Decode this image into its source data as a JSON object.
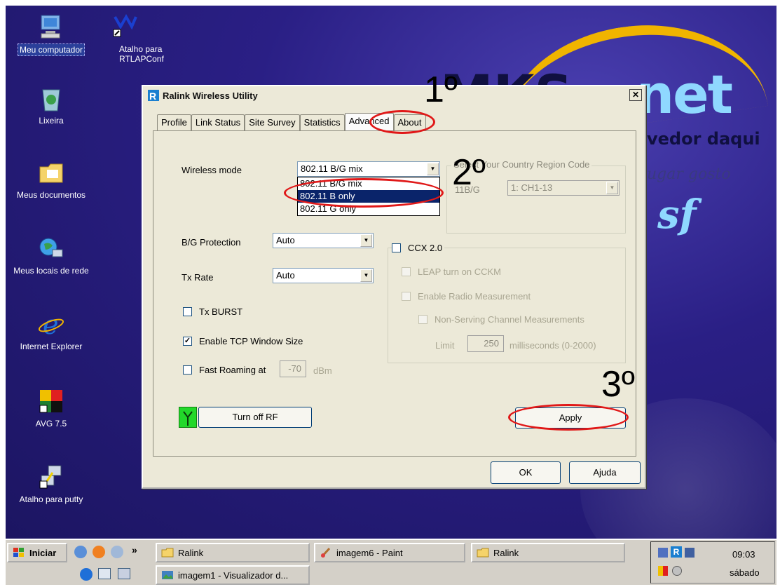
{
  "desktop": {
    "icons": [
      {
        "label": "Meu computador",
        "icon": "computer-icon"
      },
      {
        "label": "Atalho para\nRTLAPConf",
        "icon": "ralink-shortcut-icon"
      },
      {
        "label": "Lixeira",
        "icon": "recycle-bin-icon"
      },
      {
        "label": "Meus documentos",
        "icon": "folder-icon"
      },
      {
        "label": "Meus locais de rede",
        "icon": "network-icon"
      },
      {
        "label": "Internet Explorer",
        "icon": "ie-icon"
      },
      {
        "label": "AVG 7.5",
        "icon": "avg-icon"
      },
      {
        "label": "Atalho para putty",
        "icon": "putty-icon"
      }
    ],
    "wallpaper": {
      "brand": "net",
      "brand_prefix": "MKS",
      "tagline": "vedor daqui",
      "tagline2": "ugar gosto"
    }
  },
  "dialog": {
    "title": "Ralink Wireless Utility",
    "close_label": "✕",
    "tabs": [
      "Profile",
      "Link Status",
      "Site Survey",
      "Statistics",
      "Advanced",
      "About"
    ],
    "active_tab": "Advanced",
    "wireless_mode": {
      "label": "Wireless mode",
      "value": "802.11 B/G mix",
      "options": [
        "802.11 B/G mix",
        "802.11 B only",
        "802.11 G only"
      ],
      "highlighted": "802.11 B only"
    },
    "country_region": {
      "legend": "Select Your Country Region Code",
      "band_label": "11B/G",
      "value": "1: CH1-13"
    },
    "bg_protection": {
      "label": "B/G Protection",
      "value": "Auto"
    },
    "tx_rate": {
      "label": "Tx Rate",
      "value": "Auto"
    },
    "tx_burst": {
      "label": "Tx BURST",
      "checked": false
    },
    "tcp_window": {
      "label": "Enable TCP Window Size",
      "checked": true
    },
    "fast_roaming": {
      "label": "Fast Roaming at",
      "value": "-70",
      "unit": "dBm",
      "checked": false
    },
    "ccx": {
      "label": "CCX 2.0",
      "leap": "LEAP turn on CCKM",
      "radio_measure": "Enable Radio Measurement",
      "non_serving": "Non-Serving Channel Measurements",
      "limit_label": "Limit",
      "limit_value": "250",
      "limit_unit": "milliseconds (0-2000)"
    },
    "turn_off_rf": "Turn off RF",
    "apply": "Apply",
    "ok": "OK",
    "help": "Ajuda"
  },
  "annotations": {
    "step1": "1º",
    "step2": "2º",
    "step3": "3º",
    "ring_color": "#e01818"
  },
  "taskbar": {
    "start": "Iniciar",
    "chevron": "»",
    "items": [
      "Ralink",
      "imagem6 - Paint",
      "Ralink",
      "imagem1 - Visualizador d..."
    ],
    "clock": "09:03",
    "day": "sábado"
  }
}
